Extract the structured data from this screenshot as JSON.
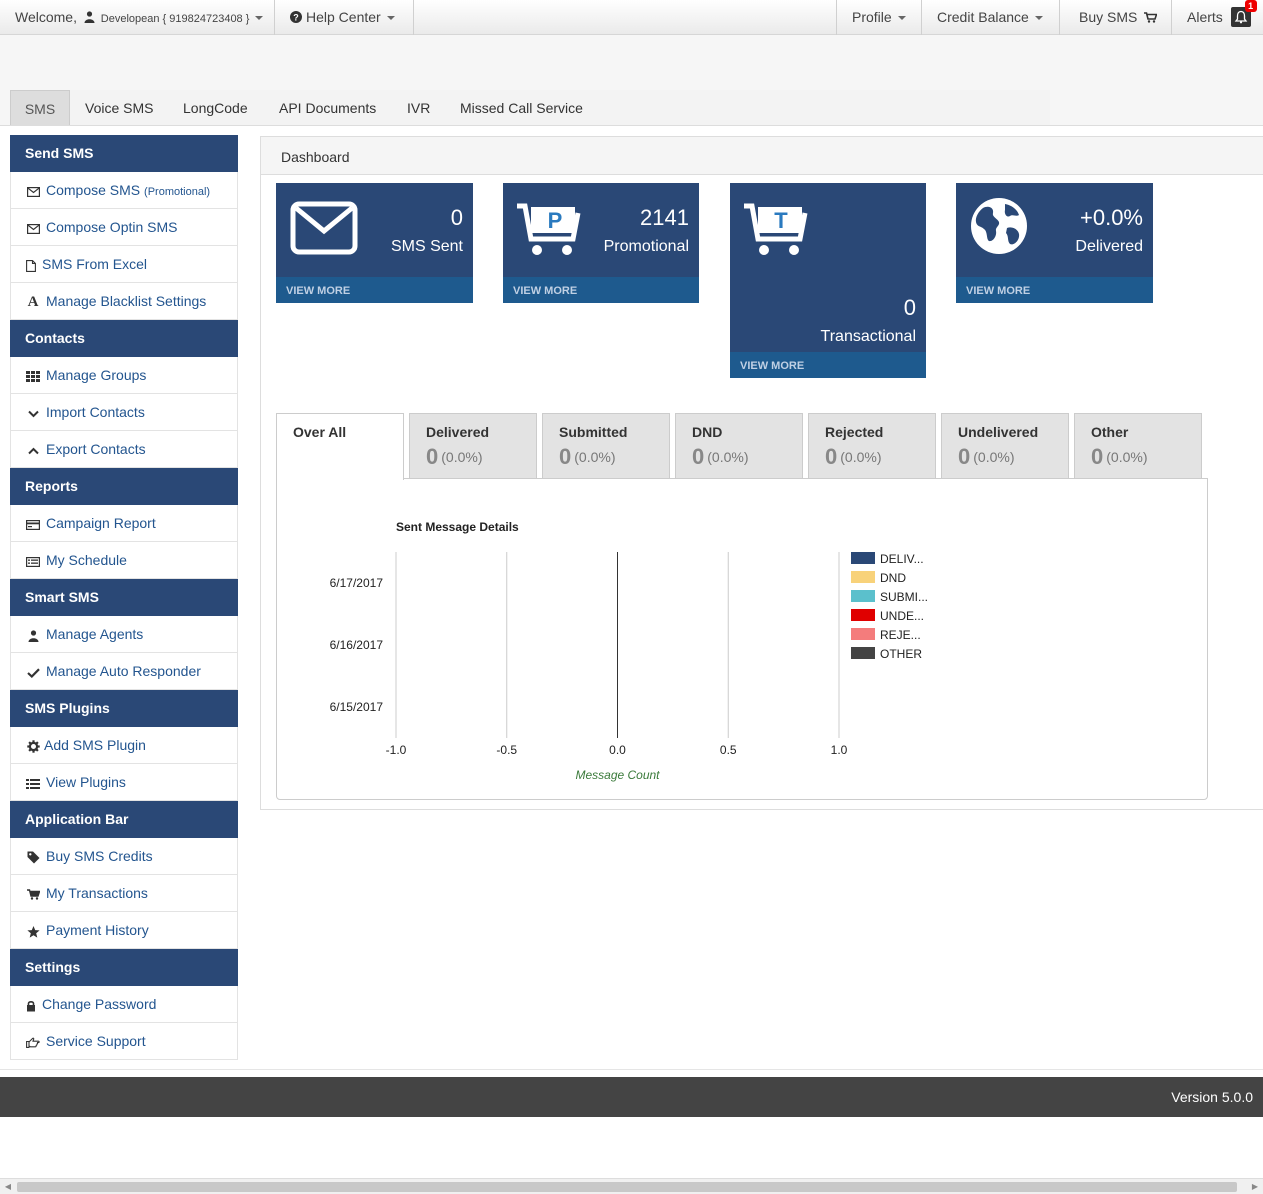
{
  "topbar": {
    "welcome": "Welcome,",
    "user": "Developean { 919824723408 }",
    "help": "Help Center",
    "profile": "Profile",
    "credit": "Credit Balance",
    "buy": "Buy SMS",
    "alerts": "Alerts",
    "alert_count": "1"
  },
  "tabs": [
    "SMS",
    "Voice SMS",
    "LongCode",
    "API Documents",
    "IVR",
    "Missed Call Service"
  ],
  "sidebar": {
    "send_sms": "Send SMS",
    "compose": "Compose SMS",
    "compose_note": "(Promotional)",
    "compose_optin": "Compose Optin SMS",
    "from_excel": "SMS From Excel",
    "blacklist": "Manage Blacklist Settings",
    "contacts": "Contacts",
    "manage_groups": "Manage Groups",
    "import_contacts": "Import Contacts",
    "export_contacts": "Export Contacts",
    "reports": "Reports",
    "campaign_report": "Campaign Report",
    "my_schedule": "My Schedule",
    "smart_sms": "Smart SMS",
    "manage_agents": "Manage Agents",
    "auto_responder": "Manage Auto Responder",
    "sms_plugins": "SMS Plugins",
    "add_plugin": "Add SMS Plugin",
    "view_plugins": "View Plugins",
    "app_bar": "Application Bar",
    "buy_credits": "Buy SMS Credits",
    "my_transactions": "My Transactions",
    "payment_history": "Payment History",
    "settings": "Settings",
    "change_password": "Change Password",
    "service_support": "Service Support"
  },
  "dashboard": {
    "title": "Dashboard",
    "view_more": "VIEW MORE",
    "tiles": {
      "sent": {
        "value": "0",
        "label": "SMS Sent"
      },
      "promotional": {
        "value": "2141",
        "label": "Promotional"
      },
      "transactional": {
        "value": "0",
        "label": "Transactional"
      },
      "delivered": {
        "value": "+0.0%",
        "label": "Delivered"
      }
    }
  },
  "stats": [
    {
      "title": "Over All",
      "value": "",
      "pct": ""
    },
    {
      "title": "Delivered",
      "value": "0",
      "pct": "(0.0%)"
    },
    {
      "title": "Submitted",
      "value": "0",
      "pct": "(0.0%)"
    },
    {
      "title": "DND",
      "value": "0",
      "pct": "(0.0%)"
    },
    {
      "title": "Rejected",
      "value": "0",
      "pct": "(0.0%)"
    },
    {
      "title": "Undelivered",
      "value": "0",
      "pct": "(0.0%)"
    },
    {
      "title": "Other",
      "value": "0",
      "pct": "(0.0%)"
    }
  ],
  "chart_data": {
    "type": "bar",
    "orientation": "horizontal",
    "title": "Sent Message Details",
    "xlabel": "Message Count",
    "ylabel": "",
    "categories": [
      "6/17/2017",
      "6/16/2017",
      "6/15/2017"
    ],
    "xlim": [
      -1.0,
      1.0
    ],
    "x_ticks": [
      "-1.0",
      "-0.5",
      "0.0",
      "0.5",
      "1.0"
    ],
    "grid": true,
    "legend_position": "right",
    "series": [
      {
        "name": "DELIV...",
        "color": "#2a4876",
        "values": [
          0,
          0,
          0
        ]
      },
      {
        "name": "DND",
        "color": "#f8d27a",
        "values": [
          0,
          0,
          0
        ]
      },
      {
        "name": "SUBMI...",
        "color": "#5bc0cc",
        "values": [
          0,
          0,
          0
        ]
      },
      {
        "name": "UNDE...",
        "color": "#e00000",
        "values": [
          0,
          0,
          0
        ]
      },
      {
        "name": "REJE...",
        "color": "#f47c7c",
        "values": [
          0,
          0,
          0
        ]
      },
      {
        "name": "OTHER",
        "color": "#444444",
        "values": [
          0,
          0,
          0
        ]
      }
    ]
  },
  "footer": {
    "version": "Version 5.0.0"
  }
}
